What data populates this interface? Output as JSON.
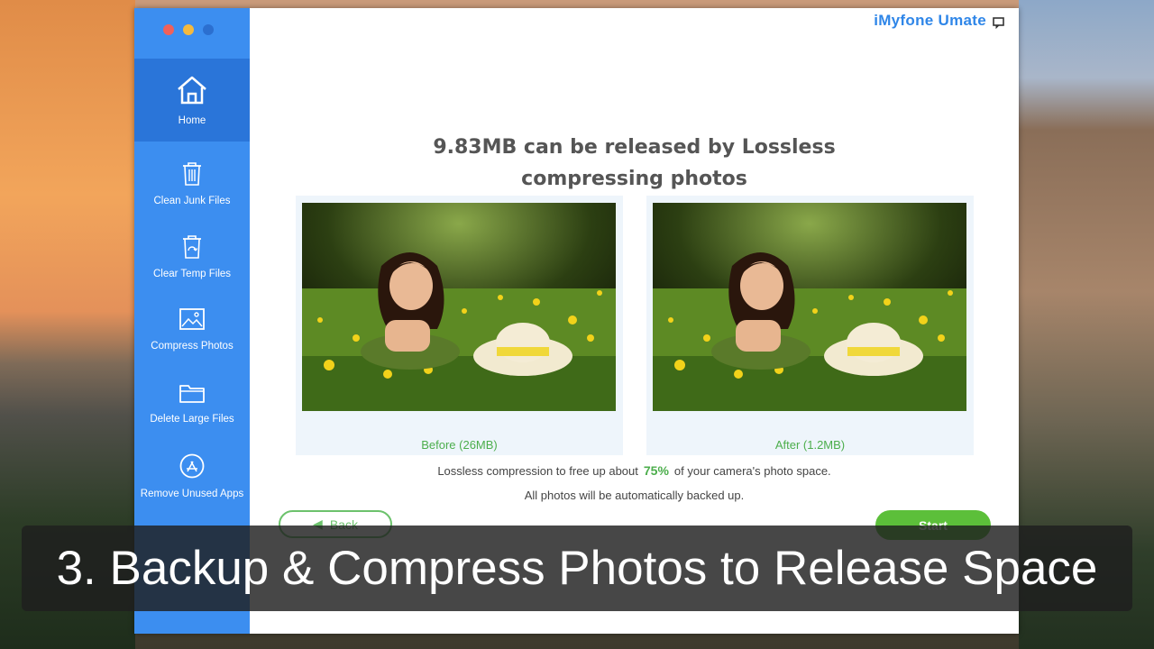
{
  "app": {
    "brand": "iMyfone Umate"
  },
  "sidebar": {
    "items": [
      {
        "label": "Home",
        "icon": "home-icon",
        "active": true
      },
      {
        "label": "Clean Junk Files",
        "icon": "trash-icon",
        "active": false
      },
      {
        "label": "Clear Temp Files",
        "icon": "temp-trash-icon",
        "active": false
      },
      {
        "label": "Compress Photos",
        "icon": "photo-icon",
        "active": false
      },
      {
        "label": "Delete Large Files",
        "icon": "folder-icon",
        "active": false
      },
      {
        "label": "Remove Unused Apps",
        "icon": "app-store-icon",
        "active": false
      }
    ]
  },
  "main": {
    "headline_line1": "9.83MB can be released by Lossless",
    "headline_line2": "compressing photos",
    "before_caption": "Before (26MB)",
    "after_caption": "After (1.2MB)",
    "info_prefix": "Lossless compression to free up about",
    "info_percent": "75%",
    "info_suffix": "of your camera's photo space.",
    "info_backup": "All photos will be automatically backed up.",
    "back_label": "Back",
    "start_label": "Start"
  },
  "overlay": {
    "caption": "3. Backup & Compress Photos to Release Space"
  },
  "colors": {
    "sidebar": "#3c8ef0",
    "sidebar_active": "#2a75d9",
    "accent_green": "#4cae4c",
    "brand_blue": "#2f86e8"
  }
}
